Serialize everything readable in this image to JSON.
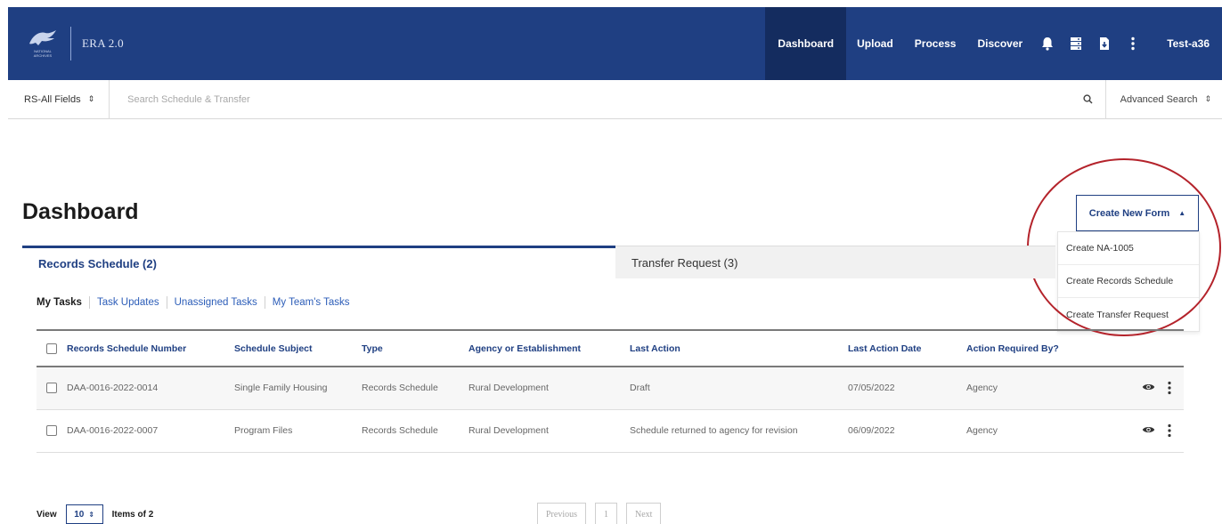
{
  "app": {
    "title": "ERA 2.0",
    "logo_text": "NATIONAL ARCHIVES"
  },
  "nav": {
    "items": [
      {
        "label": "Dashboard"
      },
      {
        "label": "Upload"
      },
      {
        "label": "Process"
      },
      {
        "label": "Discover"
      }
    ],
    "icons": [
      "bell-icon",
      "server-icon",
      "download-file-icon",
      "more-vertical-icon"
    ],
    "user": "Test-a36"
  },
  "search": {
    "field_select": "RS-All Fields",
    "placeholder": "Search Schedule & Transfer",
    "advanced": "Advanced Search"
  },
  "page": {
    "title": "Dashboard"
  },
  "create_form": {
    "label": "Create New Form",
    "options": [
      "Create NA-1005",
      "Create Records Schedule",
      "Create Transfer Request"
    ]
  },
  "tabs": [
    {
      "label": "Records Schedule (2)"
    },
    {
      "label": "Transfer Request (3)"
    }
  ],
  "subtabs": [
    "My Tasks",
    "Task Updates",
    "Unassigned Tasks",
    "My Team's Tasks"
  ],
  "table": {
    "columns": [
      "Records Schedule Number",
      "Schedule Subject",
      "Type",
      "Agency or Establishment",
      "Last Action",
      "Last Action Date",
      "Action Required By?"
    ],
    "rows": [
      {
        "number": "DAA-0016-2022-0014",
        "subject": "Single Family Housing",
        "type": "Records Schedule",
        "agency": "Rural Development",
        "last_action": "Draft",
        "date": "07/05/2022",
        "required_by": "Agency"
      },
      {
        "number": "DAA-0016-2022-0007",
        "subject": "Program Files",
        "type": "Records Schedule",
        "agency": "Rural Development",
        "last_action": "Schedule returned to agency for revision",
        "date": "06/09/2022",
        "required_by": "Agency"
      }
    ]
  },
  "footer": {
    "view_label": "View",
    "page_size": "10",
    "items_label": "Items of 2",
    "prev": "Previous",
    "page": "1",
    "next": "Next"
  },
  "colors": {
    "brand": "#1f3f82",
    "link": "#2c5db8",
    "highlight": "#b4232b"
  }
}
